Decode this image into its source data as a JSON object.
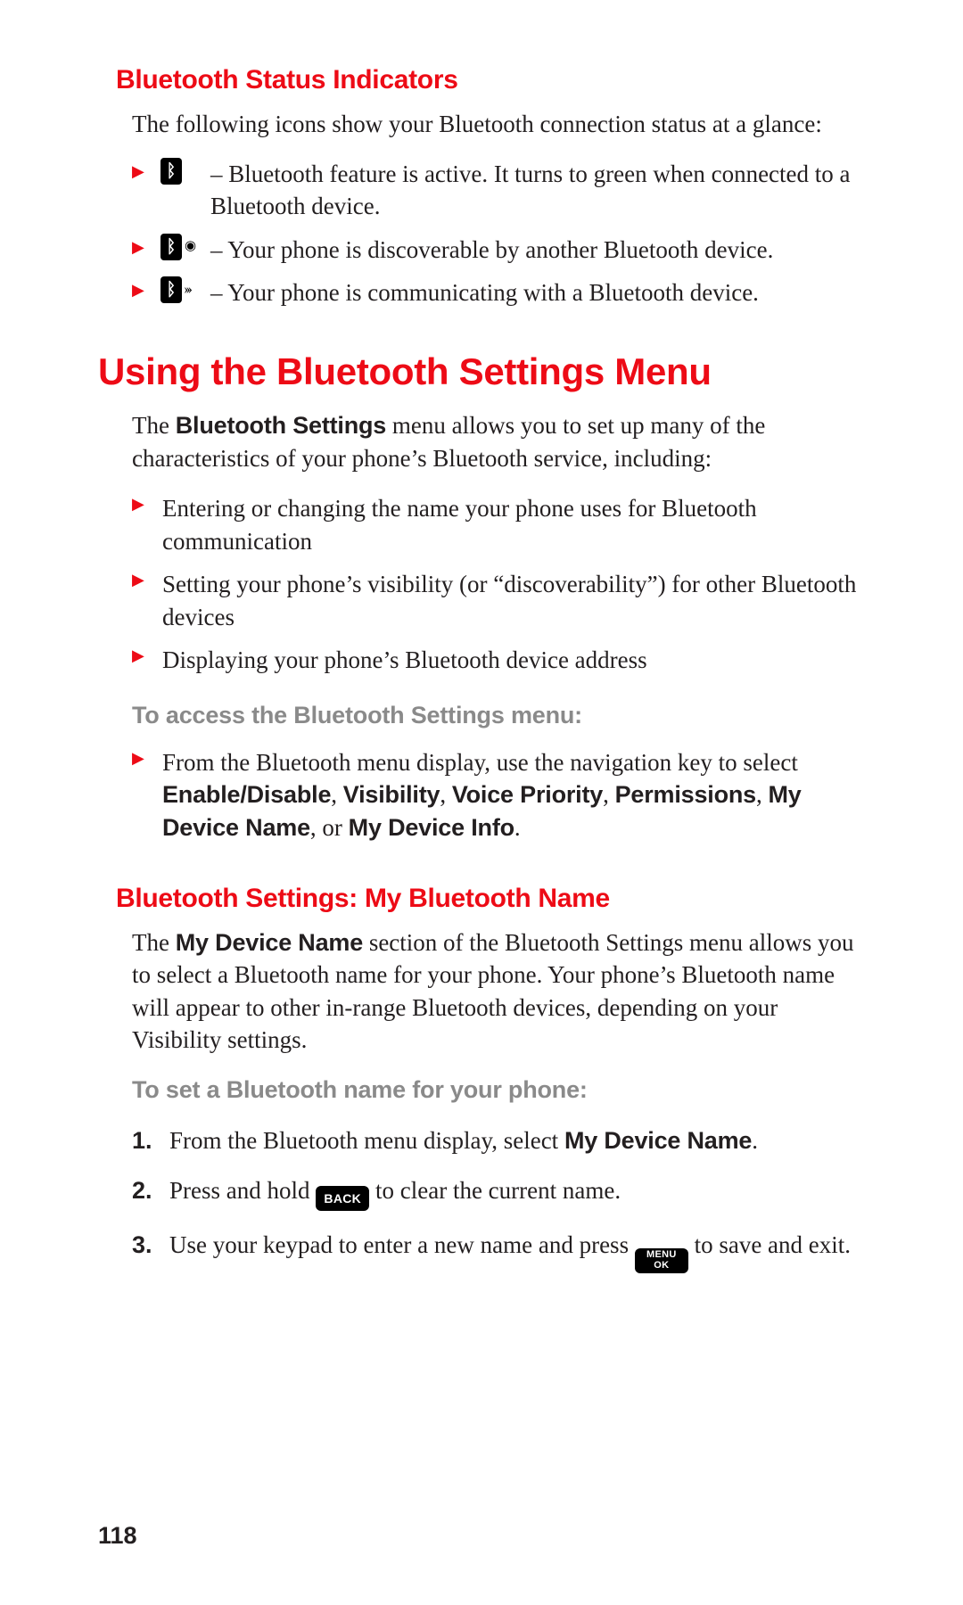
{
  "h3_indicators": "Bluetooth Status Indicators",
  "indicators_intro": "The following icons show your Bluetooth connection status at a glance:",
  "indicator_items": [
    {
      "icon": "bt-active",
      "text": " – Bluetooth feature is active. It turns to green when connected to a Bluetooth device."
    },
    {
      "icon": "bt-discoverable",
      "text": " – Your phone is discoverable by another Bluetooth device."
    },
    {
      "icon": "bt-communicating",
      "text": " – Your phone is communicating with a Bluetooth device."
    }
  ],
  "h2_settings": "Using the Bluetooth Settings Menu",
  "settings_intro_pre": "The ",
  "settings_intro_bold": "Bluetooth Settings",
  "settings_intro_post": " menu allows you to set up many of the characteristics of your phone’s Bluetooth service, including:",
  "settings_points": [
    "Entering or changing the name your phone uses for Bluetooth communication",
    "Setting your phone’s visibility (or “discoverability”) for other Bluetooth devices",
    "Displaying your phone’s Bluetooth device address"
  ],
  "settings_access_heading": "To access the Bluetooth Settings menu:",
  "settings_access_pre": "From the Bluetooth menu display, use the navigation key to select ",
  "settings_access_bold": "Enable/Disable",
  "settings_access_sep1": ", ",
  "settings_access_bold2": "Visibility",
  "settings_access_sep2": ", ",
  "settings_access_bold3": "Voice Priority",
  "settings_access_sep3": ", ",
  "settings_access_bold4": "Permissions",
  "settings_access_sep4": ", ",
  "settings_access_bold5": "My Device Name",
  "settings_access_sep5": ", or ",
  "settings_access_bold6": "My Device Info",
  "settings_access_end": ".",
  "h3_name": "Bluetooth Settings: My Bluetooth Name",
  "name_intro_pre": "The ",
  "name_intro_bold": "My Device Name",
  "name_intro_post": " section of the Bluetooth Settings menu allows you to select a Bluetooth name for your phone. Your phone’s Bluetooth name will appear to other in-range Bluetooth devices, depending on your Visibility settings.",
  "name_set_heading": "To set a Bluetooth name for your phone:",
  "step1_pre": "From the Bluetooth menu display, select ",
  "step1_bold": "My Device Name",
  "step1_end": ".",
  "step2_pre": "Press and hold ",
  "step2_key": "BACK",
  "step2_post": " to clear the current name.",
  "step3_pre": "Use your keypad to enter a new name and press ",
  "step3_key_top": "MENU",
  "step3_key_bot": "OK",
  "step3_post": " to save and exit.",
  "page_number": "118"
}
